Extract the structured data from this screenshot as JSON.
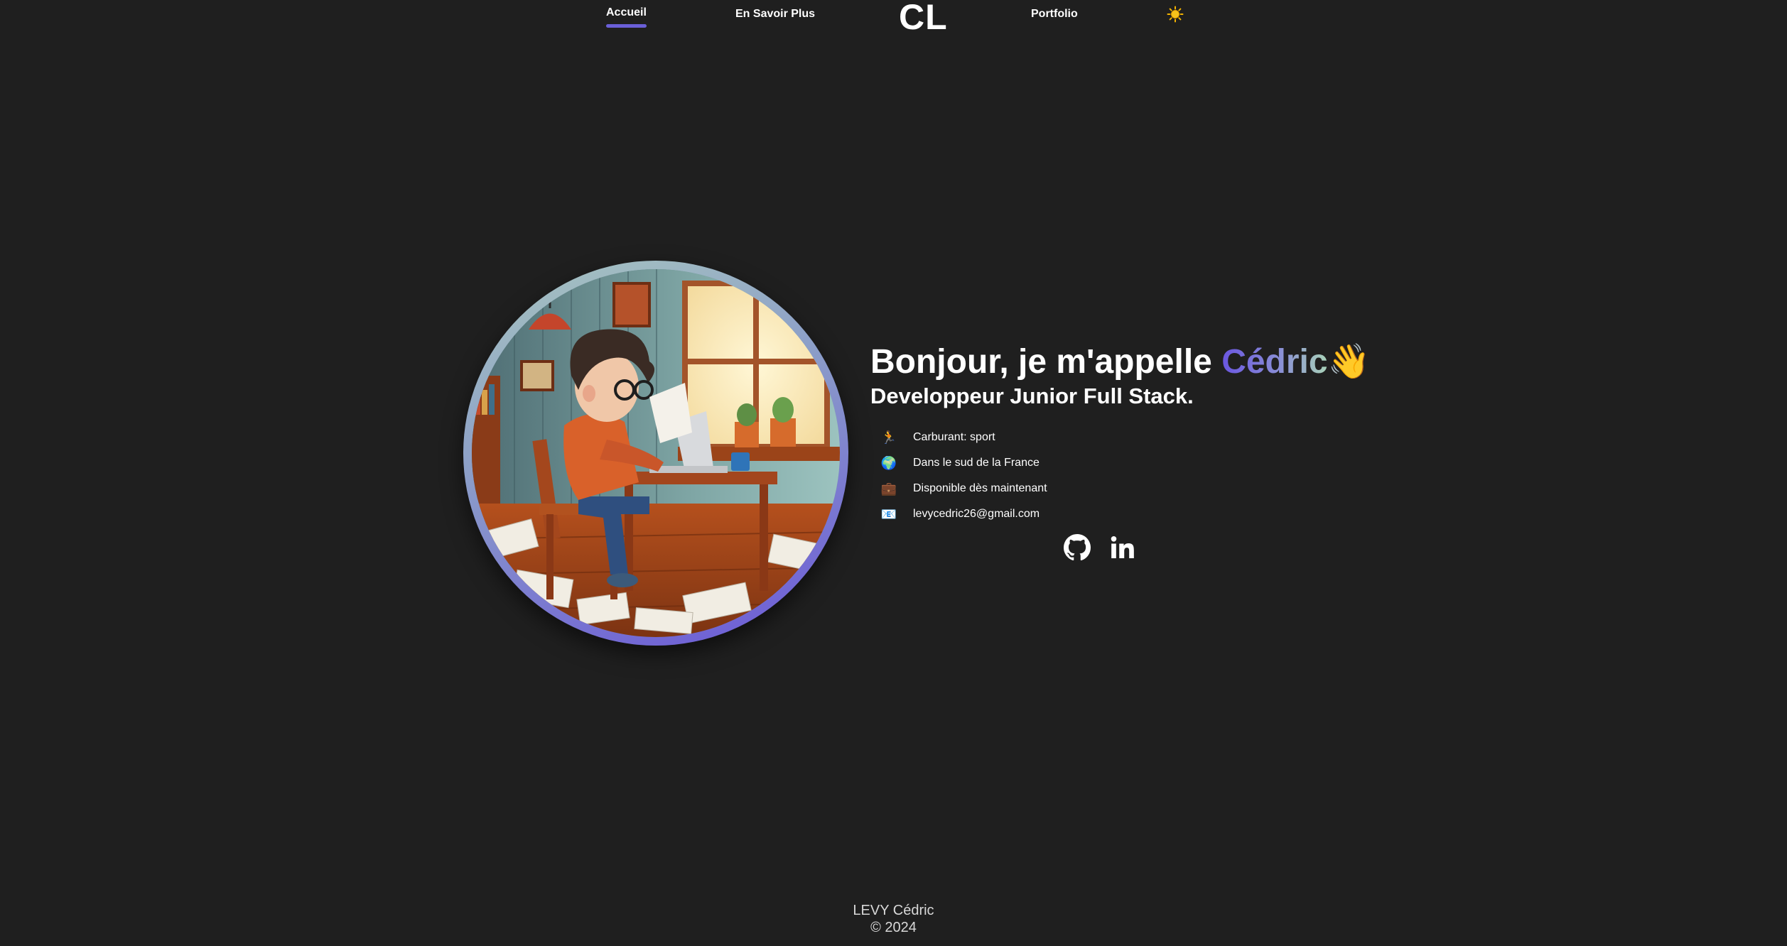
{
  "nav": {
    "items": [
      {
        "label": "Accueil",
        "active": true
      },
      {
        "label": "En Savoir Plus",
        "active": false
      },
      {
        "label": "Portfolio",
        "active": false
      }
    ],
    "logo": "CL",
    "theme_toggle_icon": "sun-icon"
  },
  "colors": {
    "background": "#1f1f1f",
    "accent": "#6a56e0",
    "accent_secondary": "#a9d2b8",
    "text": "#ffffff"
  },
  "hero": {
    "greeting": "Bonjour, je m'appelle ",
    "name": "Cédric",
    "wave_emoji": "👋",
    "subtitle": "Developpeur Junior Full Stack.",
    "info": [
      {
        "icon": "🏃",
        "icon_name": "runner-icon",
        "text": "Carburant: sport"
      },
      {
        "icon": "🌍",
        "icon_name": "globe-icon",
        "text": "Dans le sud de la France"
      },
      {
        "icon": "💼",
        "icon_name": "briefcase-icon",
        "text": "Disponible dès maintenant"
      },
      {
        "icon": "📧",
        "icon_name": "email-icon",
        "text": "levycedric26@gmail.com"
      }
    ],
    "socials": [
      {
        "icon_name": "github-icon"
      },
      {
        "icon_name": "linkedin-icon"
      }
    ]
  },
  "footer": {
    "name": "LEVY Cédric",
    "copyright": "© 2024"
  }
}
